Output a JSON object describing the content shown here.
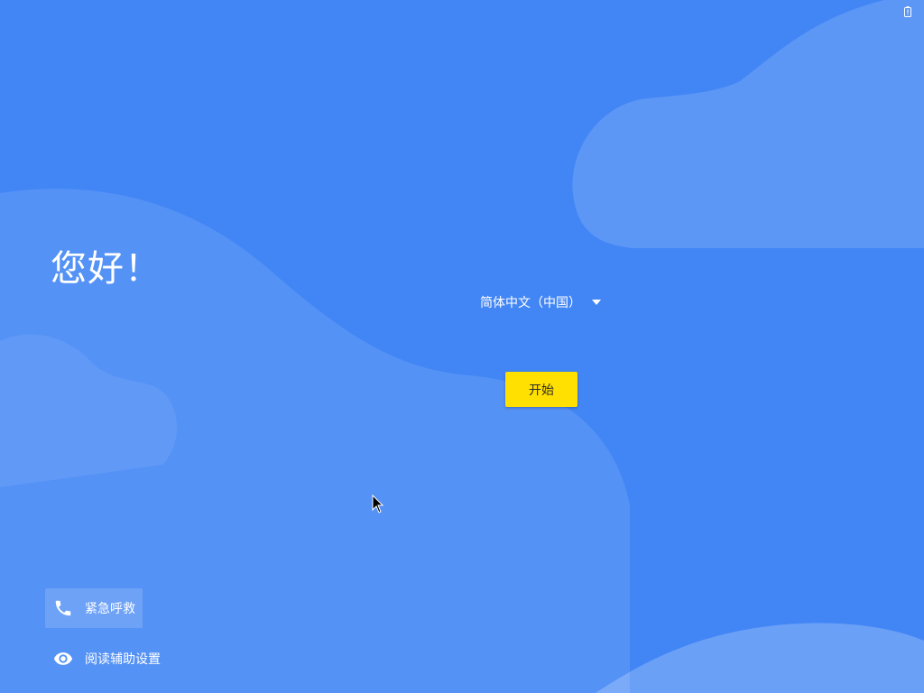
{
  "welcome": {
    "greeting": "您好！",
    "language": {
      "selected": "简体中文（中国）",
      "caret_icon": "arrow-drop-down-icon"
    },
    "start_label": "开始",
    "emergency": {
      "label": "紧急呼救",
      "icon": "phone-icon"
    },
    "accessibility": {
      "label": "阅读辅助设置",
      "icon": "eye-icon"
    }
  },
  "status_bar": {
    "icon": "battery-alert-icon"
  },
  "colors": {
    "background": "#4286f5",
    "accent_button": "#ffe000",
    "wave_light": "#6fa3f7",
    "text": "#ffffff"
  }
}
